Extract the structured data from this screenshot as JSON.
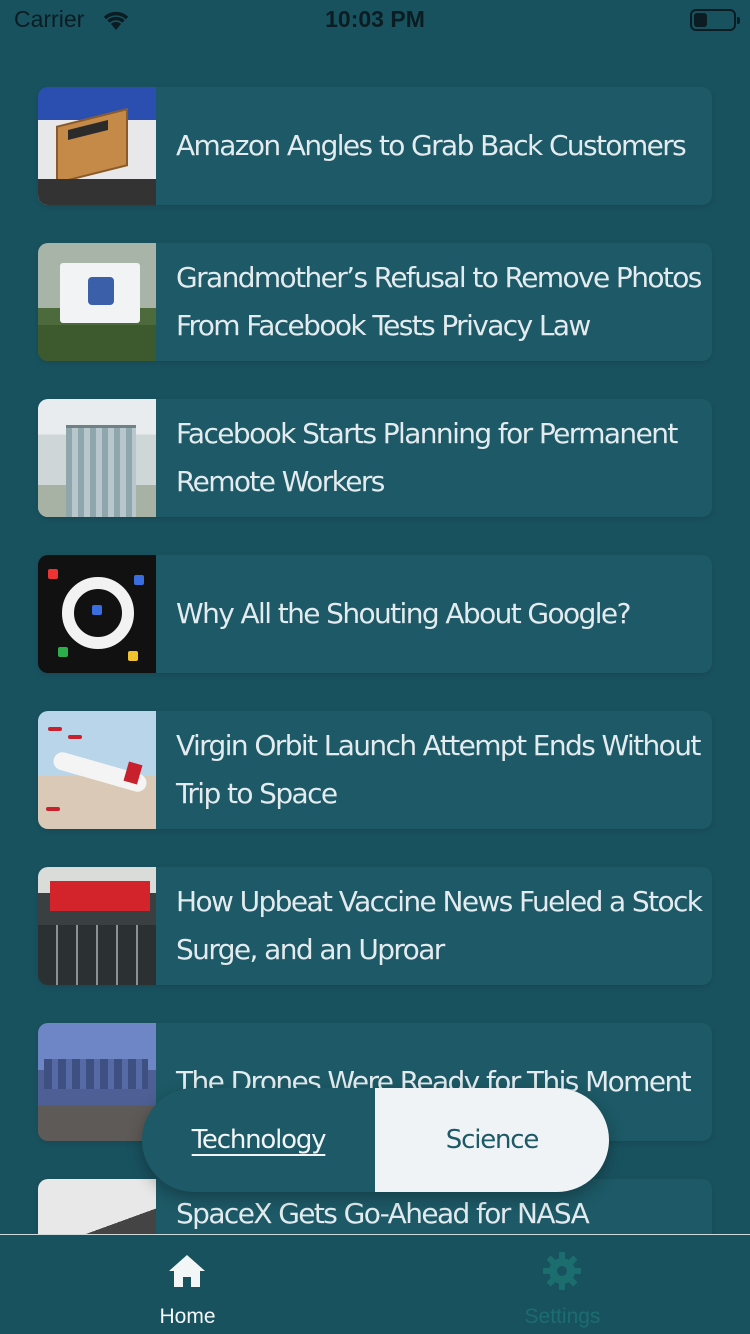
{
  "status_bar": {
    "carrier": "Carrier",
    "time": "10:03 PM"
  },
  "articles": [
    {
      "title": "Amazon Angles to Grab Back Customers",
      "thumbnail": "amazon-box-thumbnail"
    },
    {
      "title": "Grandmother’s Refusal to Remove Photos From Facebook Tests Privacy Law",
      "thumbnail": "facebook-sign-thumbnail"
    },
    {
      "title": "Facebook Starts Planning for Permanent Remote Workers",
      "thumbnail": "glass-building-thumbnail"
    },
    {
      "title": "Why All the Shouting About Google?",
      "thumbnail": "google-art-thumbnail"
    },
    {
      "title": "Virgin Orbit Launch Attempt Ends Without Trip to Space",
      "thumbnail": "virgin-plane-thumbnail"
    },
    {
      "title": "How Upbeat Vaccine News Fueled a Stock Surge, and an Uproar",
      "thumbnail": "moderna-building-thumbnail"
    },
    {
      "title": "The Drones Were Ready for This Moment",
      "thumbnail": "city-skyline-thumbnail"
    },
    {
      "title": "SpaceX Gets Go-Ahead for NASA Astronaut Launch",
      "thumbnail": "spacex-thumbnail"
    }
  ],
  "segmented_control": {
    "technology_label": "Technology",
    "science_label": "Science",
    "selected": "Technology"
  },
  "tab_bar": {
    "home_label": "Home",
    "settings_label": "Settings",
    "home_icon": "home-icon",
    "settings_icon": "gear-icon"
  },
  "colors": {
    "background": "#19525f",
    "card": "#1d5966",
    "segment_selected_bg": "#eff3f5",
    "settings_tint": "#1b6d6e"
  }
}
